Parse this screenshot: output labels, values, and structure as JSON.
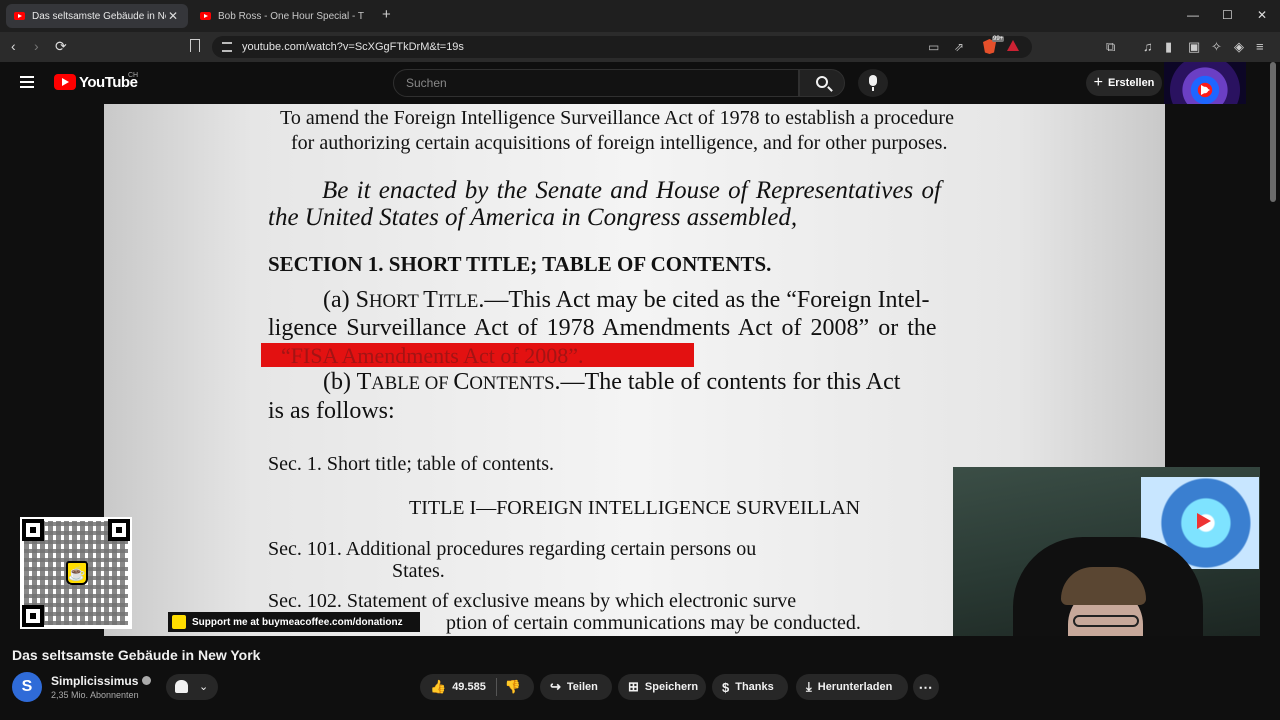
{
  "browser": {
    "tabs": [
      {
        "title": "Das seltsamste Gebäude in New",
        "close": "✕"
      },
      {
        "title": "Bob Ross - One Hour Special - The G"
      }
    ],
    "new_tab": "+",
    "window_controls": {
      "minimize": "—",
      "maximize": "☐",
      "close": "✕"
    },
    "nav": {
      "back": "‹",
      "forward": "›",
      "reload": "⟳"
    },
    "url": "youtube.com/watch?v=ScXGgFTkDrM&t=19s",
    "brave_badge": "99+"
  },
  "youtube": {
    "logo_text": "YouTube",
    "country_code": "CH",
    "search_placeholder": "Suchen",
    "create_label": "Erstellen"
  },
  "document": {
    "purpose_line1": "To amend the Foreign Intelligence Surveillance Act of 1978 to establish a procedure",
    "purpose_line2": "for authorizing certain acquisitions of foreign intelligence, and for other purposes.",
    "enact_line1": "Be it enacted by the Senate and House of Representatives of",
    "enact_line2": "the United States of America in Congress assembled,",
    "section_heading": "SECTION 1. SHORT TITLE; TABLE OF CONTENTS.",
    "a_prefix": "(a) ",
    "a_sc1": "S",
    "a_sc1b": "HORT ",
    "a_sc2": "T",
    "a_sc2b": "ITLE",
    "a_text": ".—This Act may be cited as the “Foreign Intel-",
    "a_line2": "ligence Surveillance Act of 1978 Amendments Act of 2008” or the",
    "a_highlight": "“FISA Amendments Act of 2008”.",
    "b_prefix": "(b) ",
    "b_sc1": "T",
    "b_sc1b": "ABLE OF ",
    "b_sc2": "C",
    "b_sc2b": "ONTENTS",
    "b_text": ".—The table of contents for this Act",
    "b_line2": "is as follows:",
    "toc_sec1": "Sec. 1. Short title; table of contents.",
    "title_i": "TITLE I—FOREIGN INTELLIGENCE SURVEILLAN",
    "toc_101": "Sec. 101. Additional procedures regarding certain persons ou",
    "toc_101_cont": "States.",
    "toc_102": "Sec. 102. Statement of exclusive means by which electronic surve",
    "toc_102_cont": "ption of certain communications may be conducted."
  },
  "overlay": {
    "support_text": "Support me at buymeacoffee.com/donationz"
  },
  "video": {
    "title": "Das seltsamste Gebäude in New York"
  },
  "channel": {
    "avatar_letter": "S",
    "name": "Simplicissimus",
    "subscribers": "2,35 Mio. Abonnenten"
  },
  "actions": {
    "likes": "49.585",
    "share": "Teilen",
    "save": "Speichern",
    "thanks": "Thanks",
    "download": "Herunterladen",
    "more": "⋯"
  },
  "colors": {
    "youtube_red": "#ff0000",
    "highlight_red": "#e31111",
    "background": "#0f0f0f"
  }
}
